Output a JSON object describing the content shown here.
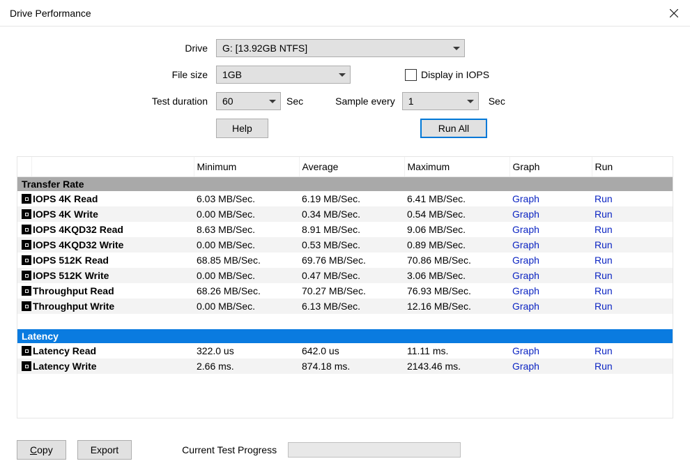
{
  "window": {
    "title": "Drive Performance"
  },
  "config": {
    "drive_label": "Drive",
    "drive_value": "G: [13.92GB NTFS]",
    "filesize_label": "File size",
    "filesize_value": "1GB",
    "display_iops_label": "Display in IOPS",
    "display_iops_checked": false,
    "test_duration_label": "Test duration",
    "test_duration_value": "60",
    "test_duration_unit": "Sec",
    "sample_every_label": "Sample every",
    "sample_every_value": "1",
    "sample_every_unit": "Sec",
    "help_label": "Help",
    "run_all_label": "Run All"
  },
  "table": {
    "headers": {
      "name": "",
      "min": "Minimum",
      "avg": "Average",
      "max": "Maximum",
      "graph": "Graph",
      "run": "Run"
    },
    "section_transfer": "Transfer Rate",
    "section_latency": "Latency",
    "link_graph": "Graph",
    "link_run": "Run",
    "transfer_rows": [
      {
        "name": "IOPS 4K Read",
        "min": "6.03 MB/Sec.",
        "avg": "6.19 MB/Sec.",
        "max": "6.41 MB/Sec."
      },
      {
        "name": "IOPS 4K Write",
        "min": "0.00 MB/Sec.",
        "avg": "0.34 MB/Sec.",
        "max": "0.54 MB/Sec."
      },
      {
        "name": "IOPS 4KQD32 Read",
        "min": "8.63 MB/Sec.",
        "avg": "8.91 MB/Sec.",
        "max": "9.06 MB/Sec."
      },
      {
        "name": "IOPS 4KQD32 Write",
        "min": "0.00 MB/Sec.",
        "avg": "0.53 MB/Sec.",
        "max": "0.89 MB/Sec."
      },
      {
        "name": "IOPS 512K Read",
        "min": "68.85 MB/Sec.",
        "avg": "69.76 MB/Sec.",
        "max": "70.86 MB/Sec."
      },
      {
        "name": "IOPS 512K Write",
        "min": "0.00 MB/Sec.",
        "avg": "0.47 MB/Sec.",
        "max": "3.06 MB/Sec."
      },
      {
        "name": "Throughput Read",
        "min": "68.26 MB/Sec.",
        "avg": "70.27 MB/Sec.",
        "max": "76.93 MB/Sec."
      },
      {
        "name": "Throughput Write",
        "min": "0.00 MB/Sec.",
        "avg": "6.13 MB/Sec.",
        "max": "12.16 MB/Sec."
      }
    ],
    "latency_rows": [
      {
        "name": "Latency Read",
        "min": "322.0 us",
        "avg": "642.0 us",
        "max": "11.11 ms."
      },
      {
        "name": "Latency Write",
        "min": "2.66 ms.",
        "avg": "874.18 ms.",
        "max": "2143.46 ms."
      }
    ]
  },
  "footer": {
    "copy_label": "Copy",
    "export_label": "Export",
    "progress_label": "Current Test Progress"
  },
  "chart_data": {
    "type": "table",
    "title": "Drive Performance",
    "sections": [
      {
        "name": "Transfer Rate",
        "unit": "MB/Sec.",
        "columns": [
          "Minimum",
          "Average",
          "Maximum"
        ],
        "rows": [
          {
            "label": "IOPS 4K Read",
            "values": [
              6.03,
              6.19,
              6.41
            ]
          },
          {
            "label": "IOPS 4K Write",
            "values": [
              0.0,
              0.34,
              0.54
            ]
          },
          {
            "label": "IOPS 4KQD32 Read",
            "values": [
              8.63,
              8.91,
              9.06
            ]
          },
          {
            "label": "IOPS 4KQD32 Write",
            "values": [
              0.0,
              0.53,
              0.89
            ]
          },
          {
            "label": "IOPS 512K Read",
            "values": [
              68.85,
              69.76,
              70.86
            ]
          },
          {
            "label": "IOPS 512K Write",
            "values": [
              0.0,
              0.47,
              3.06
            ]
          },
          {
            "label": "Throughput Read",
            "values": [
              68.26,
              70.27,
              76.93
            ]
          },
          {
            "label": "Throughput Write",
            "values": [
              0.0,
              6.13,
              12.16
            ]
          }
        ]
      },
      {
        "name": "Latency",
        "columns": [
          "Minimum",
          "Average",
          "Maximum"
        ],
        "rows": [
          {
            "label": "Latency Read",
            "values_text": [
              "322.0 us",
              "642.0 us",
              "11.11 ms."
            ],
            "values_ms": [
              0.322,
              0.642,
              11.11
            ]
          },
          {
            "label": "Latency Write",
            "values_text": [
              "2.66 ms.",
              "874.18 ms.",
              "2143.46 ms."
            ],
            "values_ms": [
              2.66,
              874.18,
              2143.46
            ]
          }
        ]
      }
    ]
  }
}
